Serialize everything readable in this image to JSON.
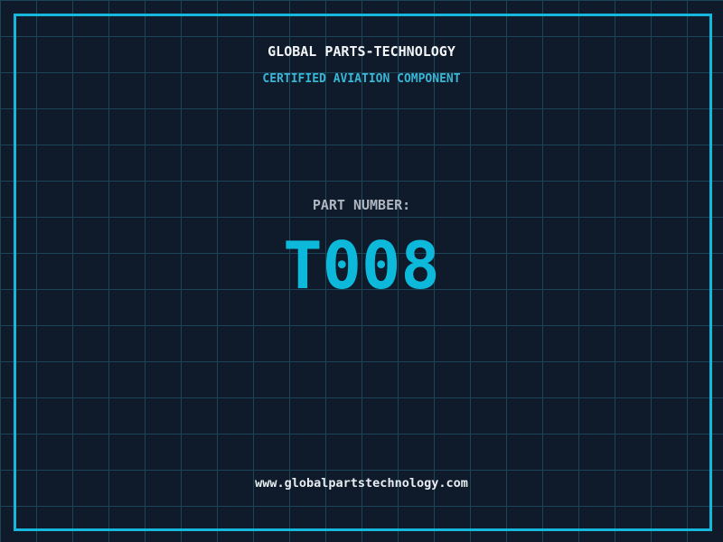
{
  "theme": {
    "background": "#0f1a2b",
    "grid_line": "#1c4559",
    "frame_border": "#16b7dd",
    "title_text": "#f2f5f7",
    "tagline_text": "#38b6d6",
    "label_text": "#aeb6c0",
    "part_number_text": "#0db9da",
    "footer_text": "#e8edf2"
  },
  "header": {
    "company_name": "GLOBAL PARTS-TECHNOLOGY",
    "tagline": "CERTIFIED AVIATION COMPONENT"
  },
  "part": {
    "label": "PART NUMBER:",
    "number": "T008"
  },
  "footer": {
    "website": "www.globalpartstechnology.com"
  }
}
